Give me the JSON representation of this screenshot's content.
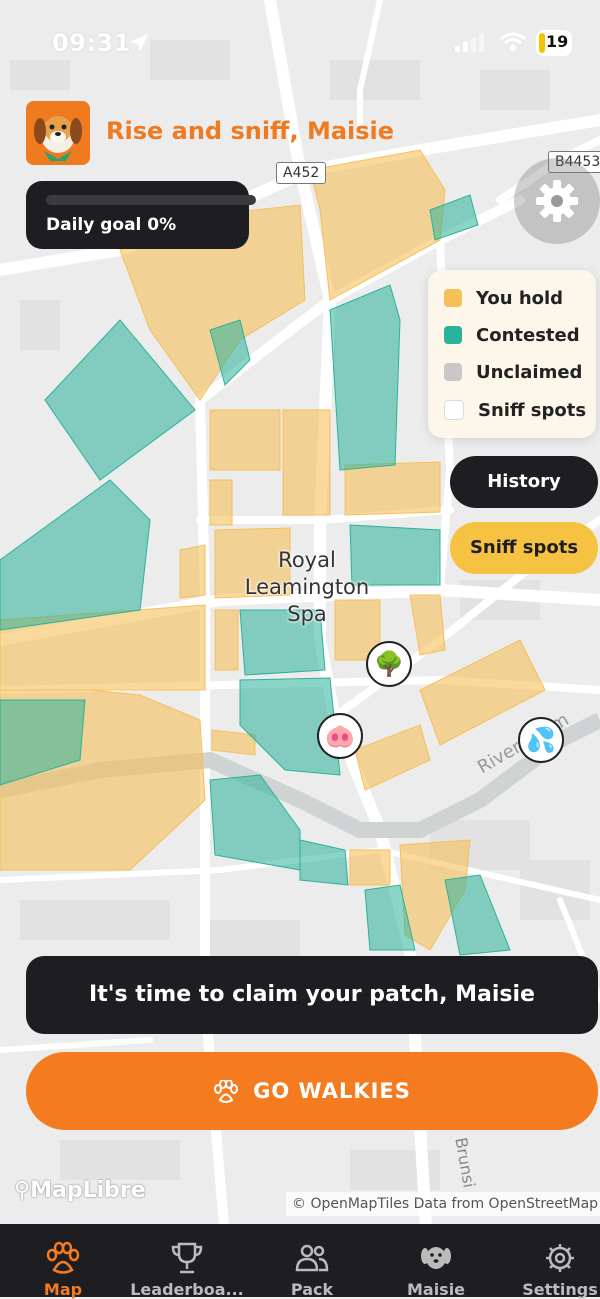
{
  "status_bar": {
    "time": "09:31",
    "battery": "19"
  },
  "header": {
    "greeting": "Rise and sniff, Maisie",
    "daily_goal_label": "Daily goal 0%",
    "daily_goal_progress": 0
  },
  "map": {
    "road_labels": [
      "A452",
      "B4453"
    ],
    "place_label_lines": [
      "Royal",
      "Leamington",
      "Spa"
    ],
    "river_label": "River Leam",
    "street_label": "Brunsi",
    "attribution": "© OpenMapTiles Data from OpenStreetMap",
    "credit": "MapLibre",
    "markers": [
      {
        "name": "tree-marker",
        "glyph": "🌳"
      },
      {
        "name": "pig-marker",
        "glyph": "🐽"
      },
      {
        "name": "water-marker",
        "glyph": "💦"
      }
    ]
  },
  "legend": {
    "items": [
      {
        "label": "You hold",
        "color": "#f5c05a"
      },
      {
        "label": "Contested",
        "color": "#2bb29a"
      },
      {
        "label": "Unclaimed",
        "color": "#c8c8c8"
      },
      {
        "label": "Sniff spots",
        "color": "#ffffff"
      }
    ]
  },
  "buttons": {
    "history": "History",
    "sniff_spots": "Sniff spots",
    "claim_message": "It's time to claim your patch, Maisie",
    "go_walkies": "GO WALKIES"
  },
  "tabs": [
    {
      "label": "Map",
      "active": true
    },
    {
      "label": "Leaderboa...",
      "active": false
    },
    {
      "label": "Pack",
      "active": false
    },
    {
      "label": "Maisie",
      "active": false
    },
    {
      "label": "Settings",
      "active": false
    }
  ],
  "colors": {
    "accent": "#f47b20",
    "dark": "#1d1d22",
    "held": "#f5c05a",
    "contested": "#2bb29a"
  }
}
